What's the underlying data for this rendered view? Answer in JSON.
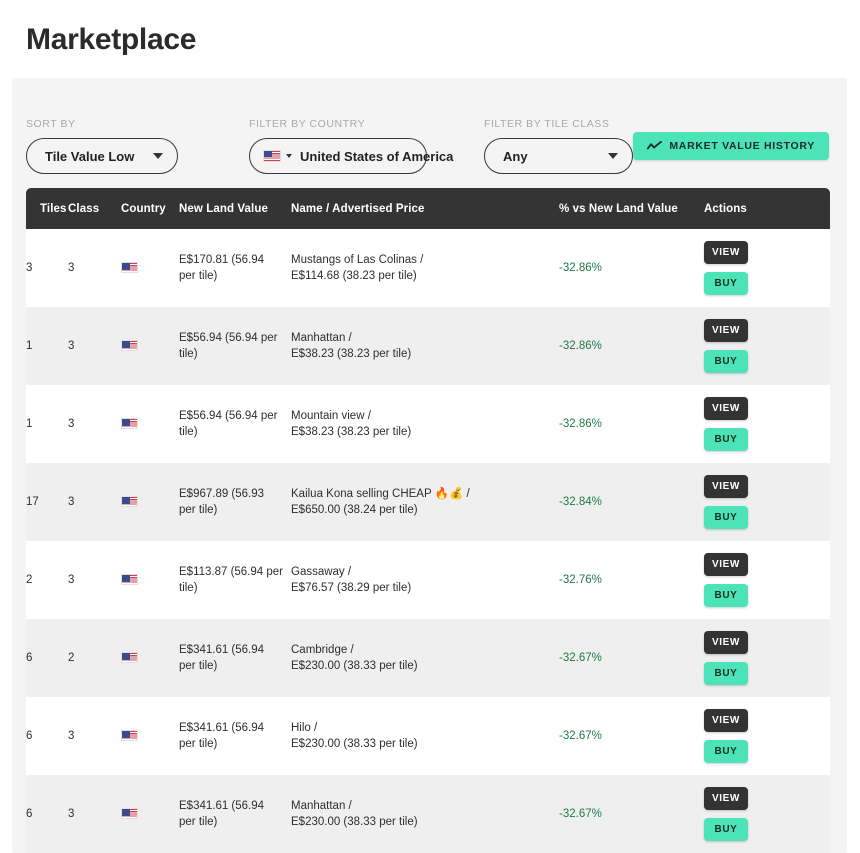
{
  "page": {
    "title": "Marketplace"
  },
  "controls": {
    "sort": {
      "label": "SORT BY",
      "value": "Tile Value Low"
    },
    "country": {
      "label": "FILTER BY COUNTRY",
      "value": "United States of America",
      "flag_icon": "us-flag-icon"
    },
    "tile_class": {
      "label": "FILTER BY TILE CLASS",
      "value": "Any"
    },
    "market_value_history": {
      "label": "MARKET VALUE HISTORY",
      "icon": "trend-line-icon"
    }
  },
  "table": {
    "columns": [
      "Tiles",
      "Class",
      "Country",
      "New Land Value",
      "Name / Advertised Price",
      "% vs New Land Value",
      "Actions"
    ],
    "action_labels": {
      "view": "VIEW",
      "buy": "BUY"
    },
    "rows": [
      {
        "tiles": "3",
        "class": "3",
        "country_flag": "us-flag-icon",
        "new_land_value": "E$170.81 (56.94 per tile)",
        "name": "Mustangs of Las Colinas /",
        "price": "E$114.68 (38.23 per tile)",
        "pct": "-32.86%"
      },
      {
        "tiles": "1",
        "class": "3",
        "country_flag": "us-flag-icon",
        "new_land_value": "E$56.94 (56.94 per tile)",
        "name": "Manhattan /",
        "price": "E$38.23 (38.23 per tile)",
        "pct": "-32.86%"
      },
      {
        "tiles": "1",
        "class": "3",
        "country_flag": "us-flag-icon",
        "new_land_value": "E$56.94 (56.94 per tile)",
        "name": "Mountain view /",
        "price": "E$38.23 (38.23 per tile)",
        "pct": "-32.86%"
      },
      {
        "tiles": "17",
        "class": "3",
        "country_flag": "us-flag-icon",
        "new_land_value": "E$967.89 (56.93 per tile)",
        "name": "Kailua Kona selling CHEAP 🔥💰 /",
        "price": "E$650.00 (38.24 per tile)",
        "pct": "-32.84%"
      },
      {
        "tiles": "2",
        "class": "3",
        "country_flag": "us-flag-icon",
        "new_land_value": "E$113.87 (56.94 per tile)",
        "name": "Gassaway /",
        "price": "E$76.57 (38.29 per tile)",
        "pct": "-32.76%"
      },
      {
        "tiles": "6",
        "class": "2",
        "country_flag": "us-flag-icon",
        "new_land_value": "E$341.61 (56.94 per tile)",
        "name": "Cambridge /",
        "price": "E$230.00 (38.33 per tile)",
        "pct": "-32.67%"
      },
      {
        "tiles": "6",
        "class": "3",
        "country_flag": "us-flag-icon",
        "new_land_value": "E$341.61 (56.94 per tile)",
        "name": "Hilo /",
        "price": "E$230.00 (38.33 per tile)",
        "pct": "-32.67%"
      },
      {
        "tiles": "6",
        "class": "3",
        "country_flag": "us-flag-icon",
        "new_land_value": "E$341.61 (56.94 per tile)",
        "name": "Manhattan /",
        "price": "E$230.00 (38.33 per tile)",
        "pct": "-32.67%"
      }
    ]
  },
  "colors": {
    "accent_teal": "#4de3b8",
    "header_dark": "#343434",
    "positive_text": "#1f7a48",
    "card_bg": "#f4f4f4"
  }
}
